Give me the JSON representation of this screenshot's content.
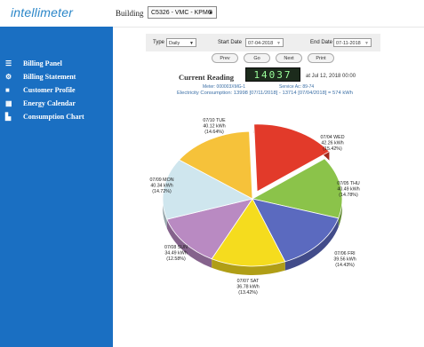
{
  "app": {
    "logo": "intellimeter"
  },
  "building": {
    "label": "Building",
    "selected": "C5326 - VMC - KPMG"
  },
  "sidebar": {
    "items": [
      {
        "label": "Billing Panel",
        "icon": "menu-icon"
      },
      {
        "label": "Billing Statement",
        "icon": "gears-icon"
      },
      {
        "label": "Customer Profile",
        "icon": "user-icon"
      },
      {
        "label": "Energy Calendar",
        "icon": "calendar-icon"
      },
      {
        "label": "Consumption Chart",
        "icon": "chart-icon"
      }
    ]
  },
  "controls": {
    "type_label": "Type",
    "type_value": "Daily",
    "start_label": "Start Date",
    "start_value": "07-04-2018",
    "end_label": "End Date",
    "end_value": "07-11-2018",
    "buttons": [
      "Prev",
      "Go",
      "Next",
      "Print"
    ]
  },
  "reading": {
    "label": "Current Reading",
    "value": "14037",
    "at": "at Jul 12, 2018 00:00",
    "meter": "Meter: 000003XMG-1",
    "service": "Service Ac: 89-74",
    "consumption": "Electricity Consumption: 13998 [07/11/2018] - 13714 [07/04/2018] = 574 kWh"
  },
  "colors": {
    "sidebar": "#1a6fc2",
    "wed": "#e23a2a",
    "thu": "#8bc34a",
    "fri": "#5b6abf",
    "sat": "#f5dc1e",
    "sun": "#b98ac2",
    "mon": "#cfe6ee",
    "tue": "#f6c23a"
  },
  "chart_data": {
    "type": "pie",
    "slices": [
      {
        "day": "WED",
        "date": "07/04 WED",
        "value": 42.26,
        "unit": "kWh",
        "percent": "(15.42%)",
        "color": "#e23a2a"
      },
      {
        "day": "THU",
        "date": "07/05 THU",
        "value": 40.49,
        "unit": "kWh",
        "percent": "(14.78%)",
        "color": "#8bc34a"
      },
      {
        "day": "FRI",
        "date": "07/06 FRI",
        "value": 39.56,
        "unit": "kWh",
        "percent": "(14.43%)",
        "color": "#5b6abf"
      },
      {
        "day": "SAT",
        "date": "07/07 SAT",
        "value": 36.78,
        "unit": "kWh",
        "percent": "(13.42%)",
        "color": "#f5dc1e"
      },
      {
        "day": "SUN",
        "date": "07/08 SUN",
        "value": 34.49,
        "unit": "kWh",
        "percent": "(12.58%)",
        "color": "#b98ac2"
      },
      {
        "day": "MON",
        "date": "07/09 MON",
        "value": 40.34,
        "unit": "kWh",
        "percent": "(14.72%)",
        "color": "#cfe6ee"
      },
      {
        "day": "TUE",
        "date": "07/10 TUE",
        "value": 40.12,
        "unit": "kWh",
        "percent": "(14.64%)",
        "color": "#f6c23a"
      }
    ]
  }
}
